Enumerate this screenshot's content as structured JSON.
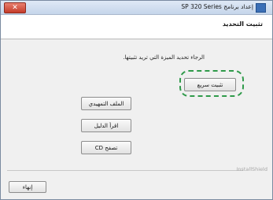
{
  "window": {
    "title": "إعداد برنامج SP 320 Series",
    "close_symbol": "✕"
  },
  "header": {
    "title": "تثبيت التحديد"
  },
  "main": {
    "prompt": "الرجاء تحديد الميزة التي تريد تثبيتها.",
    "install_button": "تثبيت سريع",
    "manual_button": "الملف التمهيدي",
    "guide_button": "اقرأ الدليل",
    "browse_button": "تصفح CD"
  },
  "footer": {
    "brand": "InstallShield",
    "finish_button": "إنهاء"
  },
  "colors": {
    "highlight": "#2f9a4a",
    "close_red": "#c43c2a"
  },
  "icons": {
    "app": "installer-app-icon",
    "close": "close-icon"
  }
}
